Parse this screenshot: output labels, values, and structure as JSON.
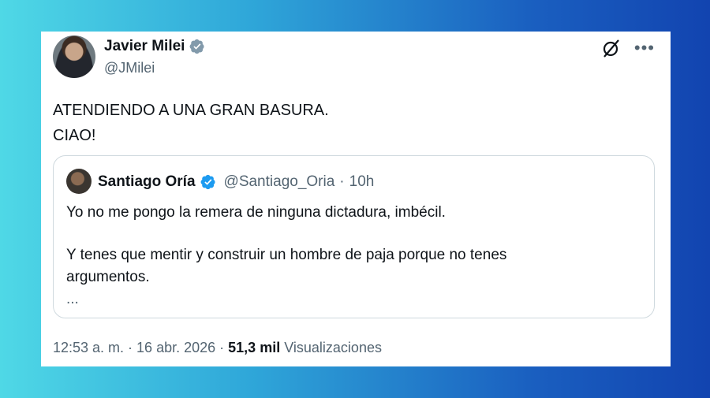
{
  "author": {
    "name": "Javier Milei",
    "handle": "@JMilei"
  },
  "tweet": {
    "lines": [
      "ATENDIENDO A UNA GRAN BASURA.",
      "CIAO!"
    ]
  },
  "quote": {
    "name": "Santiago Oría",
    "handle": "@Santiago_Oria",
    "separator": "·",
    "time": "10h",
    "line1": "Yo no me pongo la remera de ninguna dictadura, imbécil.",
    "line2": "Y tenes que mentir y construir un hombre de paja porque no tenes",
    "line3": "argumentos.",
    "more": "..."
  },
  "meta": {
    "timestamp": "12:53 a. m. · 16 abr. 2026 ·",
    "views_count": "51,3 mil",
    "views_label": "Visualizaciones"
  },
  "icons": {
    "verified": "verified-badge-icon",
    "grok": "grok-icon",
    "more": "more-options-icon"
  },
  "colors": {
    "verified": "#1d9bf0",
    "text": "#0f1419",
    "secondary": "#536471"
  }
}
